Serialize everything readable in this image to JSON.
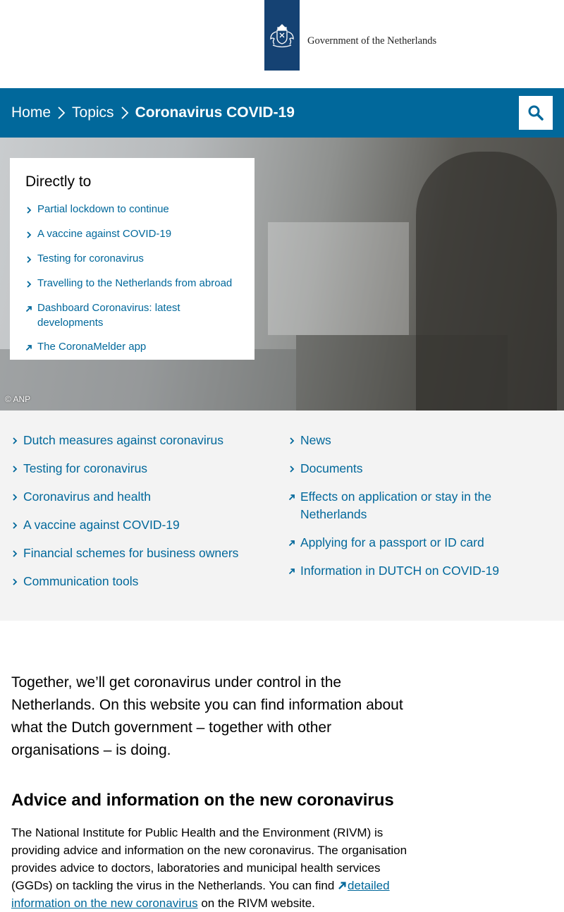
{
  "header": {
    "org_name": "Government of the Netherlands"
  },
  "breadcrumb": {
    "home": "Home",
    "topics": "Topics",
    "current": "Coronavirus COVID-19"
  },
  "hero": {
    "credit": "© ANP",
    "directly_to": {
      "title": "Directly to",
      "items": [
        {
          "label": "Partial lockdown to continue",
          "icon": "chevron-right-icon"
        },
        {
          "label": "A vaccine against COVID-19",
          "icon": "chevron-right-icon"
        },
        {
          "label": "Testing for coronavirus",
          "icon": "chevron-right-icon"
        },
        {
          "label": "Travelling to the Netherlands from abroad",
          "icon": "chevron-right-icon"
        },
        {
          "label": "Dashboard Coronavirus: latest developments",
          "icon": "external-link-icon"
        },
        {
          "label": "The CoronaMelder app",
          "icon": "external-link-icon"
        }
      ]
    }
  },
  "quick_links": {
    "left": [
      {
        "label": "Dutch measures against coronavirus",
        "icon": "chevron-right-icon"
      },
      {
        "label": "Testing for coronavirus",
        "icon": "chevron-right-icon"
      },
      {
        "label": "Coronavirus and health",
        "icon": "chevron-right-icon"
      },
      {
        "label": "A vaccine against COVID-19",
        "icon": "chevron-right-icon"
      },
      {
        "label": "Financial schemes for business owners",
        "icon": "chevron-right-icon"
      },
      {
        "label": "Communication tools",
        "icon": "chevron-right-icon"
      }
    ],
    "right": [
      {
        "label": "News",
        "icon": "chevron-right-icon"
      },
      {
        "label": "Documents",
        "icon": "chevron-right-icon"
      },
      {
        "label": "Effects on application or stay in the Netherlands",
        "icon": "external-link-icon"
      },
      {
        "label": "Applying for a passport or ID card",
        "icon": "external-link-icon"
      },
      {
        "label": "Information in DUTCH on COVID-19",
        "icon": "external-link-icon"
      }
    ]
  },
  "content": {
    "intro": "Together, we’ll get coronavirus under control in the Netherlands. On this website you can find information about what the Dutch government – together with other organisations – is doing.",
    "advice_heading": "Advice and information on the new coronavirus",
    "advice_text_before": "The National Institute for Public Health and the Environment (RIVM) is providing advice and information on the new coronavirus. The organisation provides advice to doctors, laboratories and municipal health services (GGDs) on tackling the virus in the Netherlands. You can find ",
    "advice_link": "detailed information on the new coronavirus",
    "advice_text_after": " on the RIVM website."
  },
  "colors": {
    "brand_blue": "#01689b",
    "logo_blue": "#154273",
    "section_bg": "#f3f3f3"
  }
}
